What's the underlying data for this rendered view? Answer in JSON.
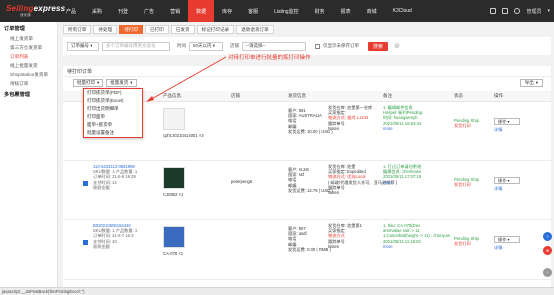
{
  "brand": {
    "name_a": "Selling",
    "name_b": "express",
    "sub": "速卖通"
  },
  "nav": [
    "产品",
    "采购",
    "刊登",
    "广告",
    "营销",
    "数据",
    "库存",
    "客服",
    "Listing监控",
    "财务",
    "报表",
    "商城",
    "K3Cloud"
  ],
  "nav_active_index": 5,
  "user": {
    "name": "管理员"
  },
  "sidebar": {
    "groups": [
      {
        "title": "订单管理",
        "items": [
          "线上发货单",
          "第三方仓发货单",
          "订单列表",
          "线上批量发货",
          "Shopstation发货单",
          "待核订单"
        ]
      },
      {
        "title": "多包裹管理",
        "items": []
      }
    ],
    "active_item": "订单列表"
  },
  "tabs": [
    "所有订单",
    "待处理",
    "待打印",
    "已打印",
    "已发货",
    "标记打印记录",
    "退款退货订单"
  ],
  "active_tab_index": 2,
  "filters": {
    "type_select": "订单编号",
    "search_placeholder": "多个订单编号用英文逗号",
    "time_label": "时间",
    "time_select": "60天以内",
    "shop_label": "店铺",
    "shop_select": "--请选择--",
    "only_label": "仅显示未保存订单",
    "search_btn": "搜索"
  },
  "panel": {
    "title": "待打印订单",
    "batch_print": "批量打印",
    "batch_ship": "批量发货",
    "export": "导出"
  },
  "dropdown": {
    "items": [
      "打印拣货单(PDF)",
      "打印拣货单(Excel)",
      "打印出货明细单",
      "打印面单",
      "面单+拣货单",
      "批量设置备注"
    ]
  },
  "annotation": "对待打印单进行批量的拣打印操作",
  "table": {
    "headers": [
      "订单号",
      "产品信息",
      "店铺",
      "发货信息",
      "备注",
      "状态",
      "操作"
    ],
    "rows": [
      {
        "order_no": "8001",
        "order_lines": [
          "订单金额: 1",
          "订单时间",
          "支付时间",
          "收款金额"
        ],
        "sku": "cpht:20210414001 ×3",
        "shop": "",
        "ship": [
          "客户: 591",
          "国家: AUSTRALIA",
          "电话",
          "邮编",
          "发货运费: 10.00 ( USD )"
        ],
        "ship2": [
          "发货仓库: 佐堡第一仓库",
          "买家指定",
          "物流方式: 雅鸿 L1234",
          "跟踪单号",
          "Notes"
        ],
        "note": [
          "1. 编辑邮件信息",
          "Hospel: 新利Pending",
          "时间: huangwenyh",
          "2021/05/11 18:53:34"
        ],
        "note_more": "more",
        "status": "Pending Ship",
        "status2": "发货打印",
        "op": "操作",
        "op_link": "详情"
      },
      {
        "order_no": "113-5423113-0581899",
        "order_lines": [
          "SKU数量: 1 产品数量: 1",
          "订单时间: 21-5-8 19:39",
          "支付时间: 14",
          "收款金额"
        ],
        "sku": "CJ0802 ×1",
        "shop": "peterpeng5",
        "ship": [
          "客户: st.2st",
          "国家: ssf",
          "电话",
          "邮编",
          "发货运费: 12.79 ( USD )"
        ],
        "ship2": [
          "发货仓库: 佐堡",
          "买家指定: Expedited",
          "物流方式: 优选Local",
          "( 邮政/代理发货人亦可、亚马逊推荐 )",
          "跟踪单号",
          "Notes"
        ],
        "note": [
          "1. 打过订单请勿更改",
          "编辑信息: chenhows",
          "2021/05/11 17:07:18"
        ],
        "note_more": "more",
        "status": "Pending Ship",
        "status2": "发货打印",
        "op": "操作",
        "op_link": "详情"
      },
      {
        "order_no": "B020210506154440",
        "order_lines": [
          "SKU数量: 1 产品数量: 1",
          "订单时间: 21-5-7 16:3",
          "支付时间: 43",
          "收款金额"
        ],
        "sku": "CA-078 ×1",
        "shop": "",
        "ship": [
          "客户: 507",
          "国家: asdf",
          "电话",
          "邮编",
          "发货运费: 0.00 ( RMB )"
        ],
        "ship2": [
          "发货仓库: 佐堡第1",
          "买家指定",
          "物流方式",
          "跟踪单号",
          "Notes"
        ],
        "note": [
          "1. Sku: CA-078(Dev",
          "aresValue null -> 11",
          "1:Cancelled(height -> 11) ; chenyum",
          "2021/05/11 11:18:02"
        ],
        "note_more": "more",
        "status": "Pending Ship",
        "status2": "发货打印",
        "op": "操作",
        "op_link": "详情"
      }
    ]
  },
  "statusbar": "javascript:__doPostBack('btnPickingExcel','')",
  "colors": {
    "accent": "#e63b2e",
    "orange_tab": "#f06b30",
    "link": "#2a6ed8",
    "topbar": "#2b2b2b"
  }
}
